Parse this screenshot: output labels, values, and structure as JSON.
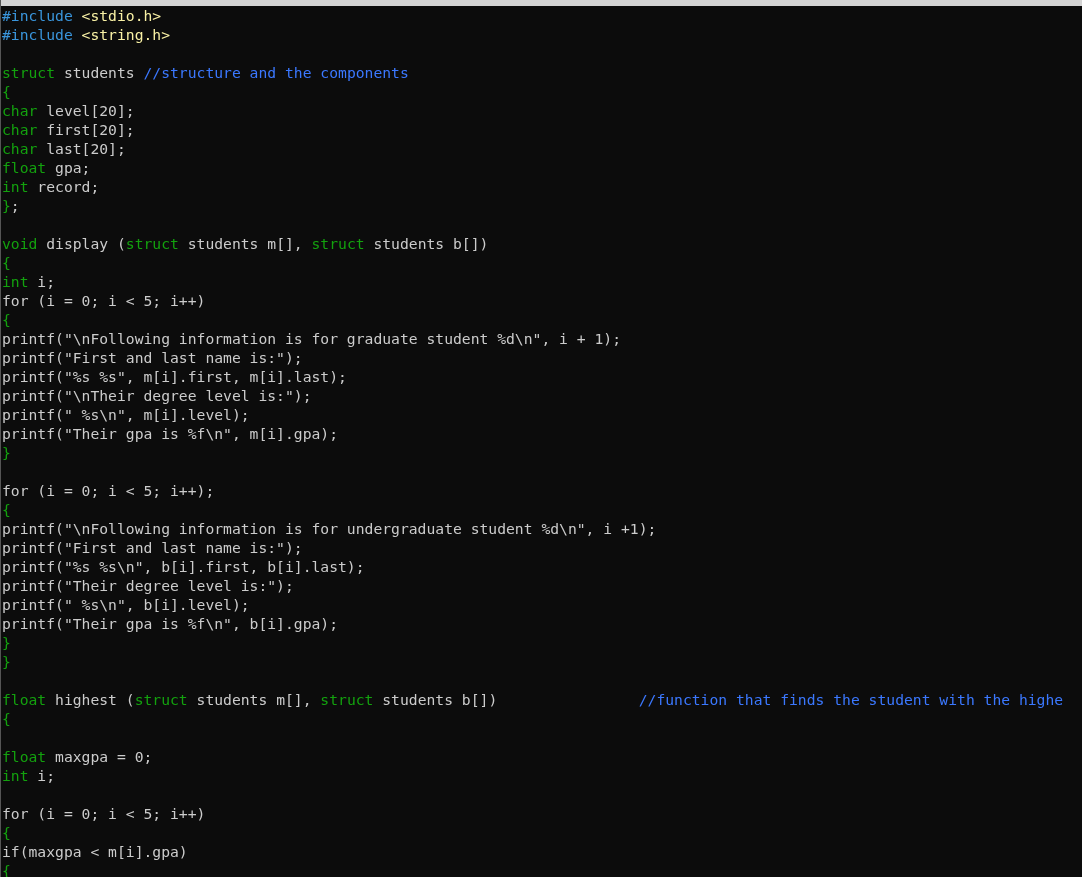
{
  "editor": {
    "lines": [
      {
        "kind": "code",
        "tokens": [
          {
            "kind": "preproc",
            "text": "#include"
          },
          {
            "kind": "header",
            "text": " <stdio.h>"
          }
        ]
      },
      {
        "kind": "code",
        "tokens": [
          {
            "kind": "preproc",
            "text": "#include"
          },
          {
            "kind": "header",
            "text": " <string.h>"
          }
        ]
      },
      {
        "kind": "blank"
      },
      {
        "kind": "code",
        "tokens": [
          {
            "kind": "keyword",
            "text": "struct"
          },
          {
            "kind": "plain",
            "text": " students "
          },
          {
            "kind": "comment",
            "text": "//structure and the components"
          }
        ]
      },
      {
        "kind": "code",
        "tokens": [
          {
            "kind": "keyword",
            "text": "{"
          }
        ]
      },
      {
        "kind": "code",
        "tokens": [
          {
            "kind": "keyword",
            "text": "char"
          },
          {
            "kind": "plain",
            "text": " level[20];"
          }
        ]
      },
      {
        "kind": "code",
        "tokens": [
          {
            "kind": "keyword",
            "text": "char"
          },
          {
            "kind": "plain",
            "text": " first[20];"
          }
        ]
      },
      {
        "kind": "code",
        "tokens": [
          {
            "kind": "keyword",
            "text": "char"
          },
          {
            "kind": "plain",
            "text": " last[20];"
          }
        ]
      },
      {
        "kind": "code",
        "tokens": [
          {
            "kind": "keyword",
            "text": "float"
          },
          {
            "kind": "plain",
            "text": " gpa;"
          }
        ]
      },
      {
        "kind": "code",
        "tokens": [
          {
            "kind": "keyword",
            "text": "int"
          },
          {
            "kind": "plain",
            "text": " record;"
          }
        ]
      },
      {
        "kind": "code",
        "tokens": [
          {
            "kind": "keyword",
            "text": "}"
          },
          {
            "kind": "plain",
            "text": ";"
          }
        ]
      },
      {
        "kind": "blank"
      },
      {
        "kind": "code",
        "tokens": [
          {
            "kind": "keyword",
            "text": "void"
          },
          {
            "kind": "plain",
            "text": " display ("
          },
          {
            "kind": "keyword",
            "text": "struct"
          },
          {
            "kind": "plain",
            "text": " students m[], "
          },
          {
            "kind": "keyword",
            "text": "struct"
          },
          {
            "kind": "plain",
            "text": " students b[])"
          }
        ]
      },
      {
        "kind": "code",
        "tokens": [
          {
            "kind": "keyword",
            "text": "{"
          }
        ]
      },
      {
        "kind": "code",
        "tokens": [
          {
            "kind": "keyword",
            "text": "int"
          },
          {
            "kind": "plain",
            "text": " i;"
          }
        ]
      },
      {
        "kind": "code",
        "tokens": [
          {
            "kind": "plain",
            "text": "for (i = 0; i < 5; i++)"
          }
        ]
      },
      {
        "kind": "code",
        "tokens": [
          {
            "kind": "keyword",
            "text": "{"
          }
        ]
      },
      {
        "kind": "code",
        "tokens": [
          {
            "kind": "plain",
            "text": "printf(\"\\nFollowing information is for graduate student %d\\n\", i + 1);"
          }
        ]
      },
      {
        "kind": "code",
        "tokens": [
          {
            "kind": "plain",
            "text": "printf(\"First and last name is:\");"
          }
        ]
      },
      {
        "kind": "code",
        "tokens": [
          {
            "kind": "plain",
            "text": "printf(\"%s %s\", m[i].first, m[i].last);"
          }
        ]
      },
      {
        "kind": "code",
        "tokens": [
          {
            "kind": "plain",
            "text": "printf(\"\\nTheir degree level is:\");"
          }
        ]
      },
      {
        "kind": "code",
        "tokens": [
          {
            "kind": "plain",
            "text": "printf(\" %s\\n\", m[i].level);"
          }
        ]
      },
      {
        "kind": "code",
        "tokens": [
          {
            "kind": "plain",
            "text": "printf(\"Their gpa is %f\\n\", m[i].gpa);"
          }
        ]
      },
      {
        "kind": "code",
        "tokens": [
          {
            "kind": "keyword",
            "text": "}"
          }
        ]
      },
      {
        "kind": "blank"
      },
      {
        "kind": "code",
        "tokens": [
          {
            "kind": "plain",
            "text": "for (i = 0; i < 5; i++);"
          }
        ]
      },
      {
        "kind": "code",
        "tokens": [
          {
            "kind": "keyword",
            "text": "{"
          }
        ]
      },
      {
        "kind": "code",
        "tokens": [
          {
            "kind": "plain",
            "text": "printf(\"\\nFollowing information is for undergraduate student %d\\n\", i +1);"
          }
        ]
      },
      {
        "kind": "code",
        "tokens": [
          {
            "kind": "plain",
            "text": "printf(\"First and last name is:\");"
          }
        ]
      },
      {
        "kind": "code",
        "tokens": [
          {
            "kind": "plain",
            "text": "printf(\"%s %s\\n\", b[i].first, b[i].last);"
          }
        ]
      },
      {
        "kind": "code",
        "tokens": [
          {
            "kind": "plain",
            "text": "printf(\"Their degree level is:\");"
          }
        ]
      },
      {
        "kind": "code",
        "tokens": [
          {
            "kind": "plain",
            "text": "printf(\" %s\\n\", b[i].level);"
          }
        ]
      },
      {
        "kind": "code",
        "tokens": [
          {
            "kind": "plain",
            "text": "printf(\"Their gpa is %f\\n\", b[i].gpa);"
          }
        ]
      },
      {
        "kind": "code",
        "tokens": [
          {
            "kind": "keyword",
            "text": "}"
          }
        ]
      },
      {
        "kind": "code",
        "tokens": [
          {
            "kind": "keyword",
            "text": "}"
          }
        ]
      },
      {
        "kind": "blank"
      },
      {
        "kind": "code",
        "tokens": [
          {
            "kind": "keyword",
            "text": "float"
          },
          {
            "kind": "plain",
            "text": " highest ("
          },
          {
            "kind": "keyword",
            "text": "struct"
          },
          {
            "kind": "plain",
            "text": " students m[], "
          },
          {
            "kind": "keyword",
            "text": "struct"
          },
          {
            "kind": "plain",
            "text": " students b[])                "
          },
          {
            "kind": "comment",
            "text": "//function that finds the student with the highe"
          }
        ]
      },
      {
        "kind": "code",
        "tokens": [
          {
            "kind": "keyword",
            "text": "{"
          }
        ]
      },
      {
        "kind": "blank"
      },
      {
        "kind": "code",
        "tokens": [
          {
            "kind": "keyword",
            "text": "float"
          },
          {
            "kind": "plain",
            "text": " maxgpa = 0;"
          }
        ]
      },
      {
        "kind": "code",
        "tokens": [
          {
            "kind": "keyword",
            "text": "int"
          },
          {
            "kind": "plain",
            "text": " i;"
          }
        ]
      },
      {
        "kind": "blank"
      },
      {
        "kind": "code",
        "tokens": [
          {
            "kind": "plain",
            "text": "for (i = 0; i < 5; i++)"
          }
        ]
      },
      {
        "kind": "code",
        "tokens": [
          {
            "kind": "keyword",
            "text": "{"
          }
        ]
      },
      {
        "kind": "code",
        "tokens": [
          {
            "kind": "plain",
            "text": "if(maxgpa < m[i].gpa)"
          }
        ]
      },
      {
        "kind": "code",
        "tokens": [
          {
            "kind": "keyword",
            "text": "{"
          }
        ]
      }
    ]
  }
}
